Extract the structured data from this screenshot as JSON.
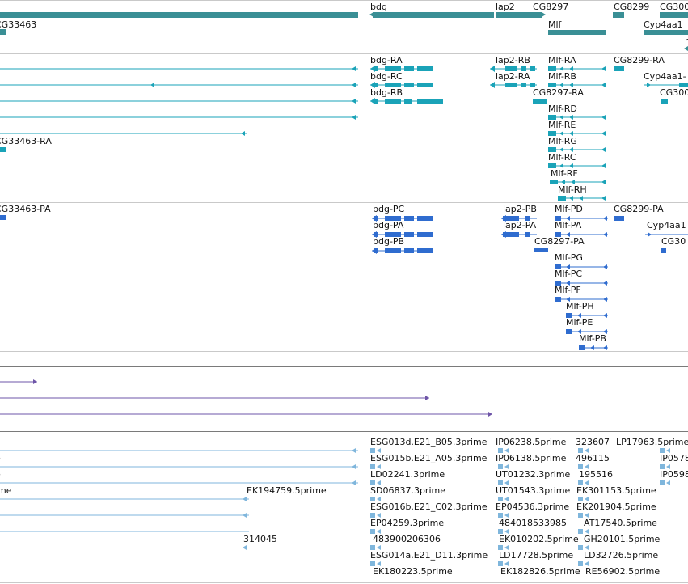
{
  "colors": {
    "gene": "#3a8f95",
    "transcript": "#1aa3b8",
    "protein": "#2f6ccf",
    "alignment": "#6e55a8",
    "est": "#7fb6dc",
    "divider": "#c9c9c9"
  },
  "tracks": [
    {
      "name": "genes",
      "labels": [
        "bdg",
        "lap2",
        "CG8297",
        "CG8299",
        "CG300",
        "CG33463",
        "Mlf",
        "Cyp4aa1",
        "n"
      ]
    },
    {
      "name": "transcripts",
      "labels": [
        "bdg-RA",
        "lap2-RB",
        "Mlf-RA",
        "CG8299-RA",
        "bdg-RC",
        "lap2-RA",
        "Mlf-RB",
        "Cyp4aa1-",
        "bdg-RB",
        "CG8297-RA",
        "CG300",
        "Mlf-RD",
        "Mlf-RE",
        "CG33463-RA",
        "Mlf-RG",
        "Mlf-RC",
        "Mlf-RF",
        "Mlf-RH"
      ]
    },
    {
      "name": "proteins",
      "labels": [
        "CG33463-PA",
        "bdg-PC",
        "lap2-PB",
        "Mlf-PD",
        "CG8299-PA",
        "bdg-PA",
        "lap2-PA",
        "Mlf-PA",
        "Cyp4aa1",
        "bdg-PB",
        "CG8297-PA",
        "CG30",
        "Mlf-PG",
        "Mlf-PC",
        "Mlf-PF",
        "Mlf-PH",
        "Mlf-PE",
        "Mlf-PB"
      ]
    },
    {
      "name": "ests",
      "labels": [
        "ESG013d.E21_B05.3prime",
        "IP06238.5prime",
        "323607",
        "LP17963.5prime",
        "e",
        "ESG015b.E21_A05.3prime",
        "IP06138.5prime",
        "496115",
        "IP0578",
        "e",
        "LD02241.3prime",
        "UT01232.3prime",
        "195516",
        "IP0598",
        "ime",
        "EK194759.5prime",
        "SD06837.3prime",
        "UT01543.3prime",
        "EK301153.5prime",
        "ESG016b.E21_C02.3prime",
        "EP04536.3prime",
        "EK201904.5prime",
        "EP04259.3prime",
        "484018533985",
        "AT17540.5prime",
        "314045",
        "483900206306",
        "EK010202.5prime",
        "GH20101.5prime",
        "ESG014a.E21_D11.3prime",
        "LD17728.5prime",
        "LD32726.5prime",
        "EK180223.5prime",
        "EK182826.5prime",
        "RE56902.5prime"
      ]
    }
  ]
}
